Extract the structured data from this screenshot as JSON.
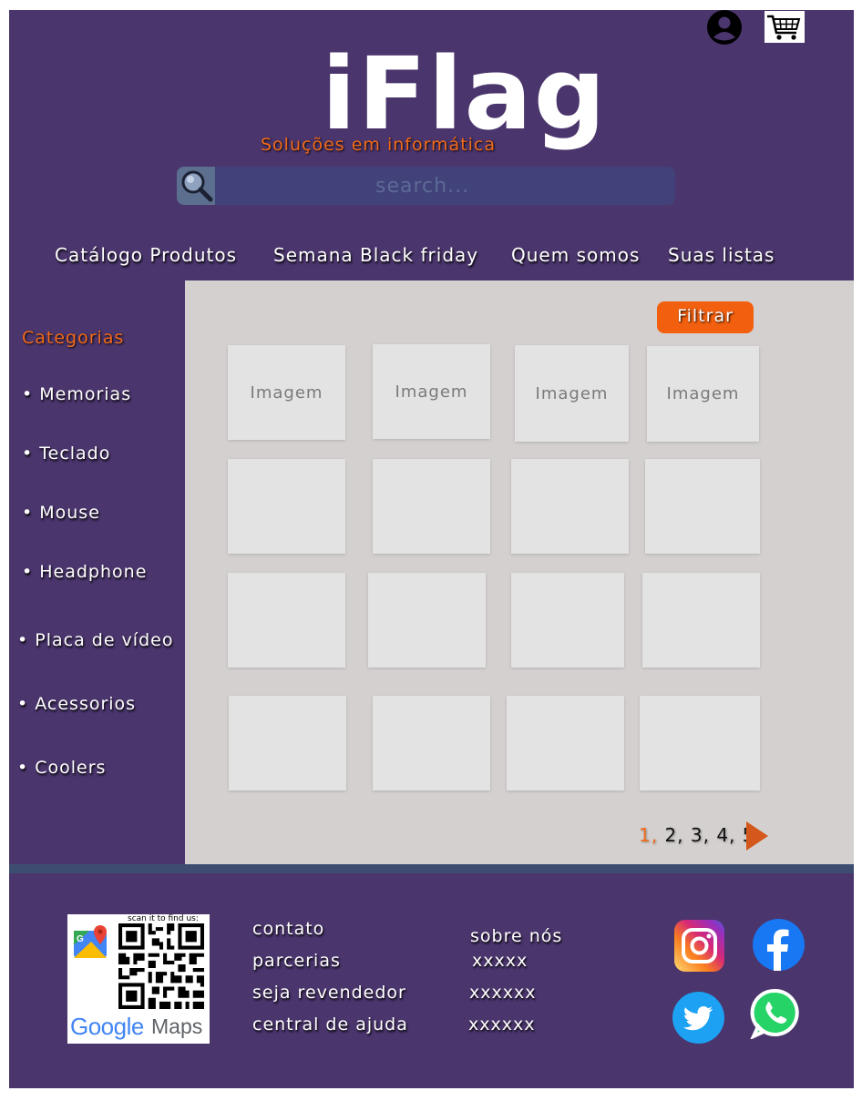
{
  "header": {
    "logo": "iFlag",
    "tagline": "Soluções em informática",
    "search_placeholder": "search...",
    "icons": {
      "account": "account-icon",
      "cart": "cart-icon"
    }
  },
  "nav": {
    "items": [
      "Catálogo Produtos",
      "Semana Black friday",
      "Quem somos",
      "Suas listas"
    ]
  },
  "sidebar": {
    "title": "Categorias",
    "items": [
      "• Memorias",
      "• Teclado",
      "• Mouse",
      "• Headphone",
      "• Placa de vídeo",
      "• Acessorios",
      "• Coolers"
    ]
  },
  "main": {
    "filter_label": "Filtrar",
    "card_label": "Imagem"
  },
  "pagination": {
    "current": "1,",
    "rest": " 2, 3, 4, 5"
  },
  "footer": {
    "col1": [
      "contato",
      "parcerias",
      "seja revendedor",
      "central de ajuda"
    ],
    "col2": [
      "sobre nós",
      "xxxxx",
      "xxxxxx",
      "xxxxxx"
    ],
    "qr": {
      "caption": "scan it to find us:",
      "google": "Google",
      "maps": "Maps"
    },
    "social": [
      "instagram-icon",
      "facebook-icon",
      "twitter-icon",
      "whatsapp-icon"
    ]
  },
  "colors": {
    "purple": "#4a356c",
    "orange": "#f26a1b",
    "content_bg": "#d4d0cf"
  }
}
